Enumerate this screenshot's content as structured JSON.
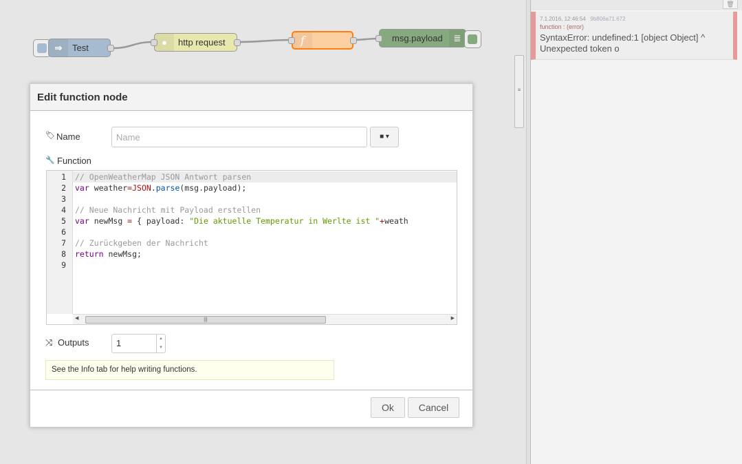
{
  "flow": {
    "nodes": [
      {
        "label": "Test",
        "color": "#a6bbcf"
      },
      {
        "label": "http request",
        "color": "#e7e7ae"
      },
      {
        "label": "",
        "color": "#fdd0a2"
      },
      {
        "label": "msg.payload",
        "color": "#87a980"
      }
    ]
  },
  "debug": {
    "timestamp": "7.1.2016, 12:46:54",
    "node_id": "9b806a71.672",
    "topic": "function : (error)",
    "payload": "SyntaxError: undefined:1 [object Object] ^ Unexpected token o"
  },
  "dialog": {
    "title": "Edit function node",
    "name_label": "Name",
    "name_placeholder": "Name",
    "name_value": "",
    "function_label": "Function",
    "code_lines": [
      [
        {
          "t": "// OpenWeatherMap JSON Antwort parsen",
          "c": "cm"
        }
      ],
      [
        {
          "t": "var",
          "c": "kw"
        },
        {
          "t": " weather",
          "c": "var"
        },
        {
          "t": "=",
          "c": "op"
        },
        {
          "t": "JSON",
          "c": "op"
        },
        {
          "t": ".",
          "c": "var"
        },
        {
          "t": "parse",
          "c": "prop"
        },
        {
          "t": "(msg.payload);",
          "c": "var"
        }
      ],
      [],
      [
        {
          "t": "// Neue Nachricht mit Payload erstellen",
          "c": "cm"
        }
      ],
      [
        {
          "t": "var",
          "c": "kw"
        },
        {
          "t": " newMsg ",
          "c": "var"
        },
        {
          "t": "=",
          "c": "op"
        },
        {
          "t": " { payload: ",
          "c": "var"
        },
        {
          "t": "\"Die aktuelle Temperatur in Werlte ist \"",
          "c": "str"
        },
        {
          "t": "+",
          "c": "op"
        },
        {
          "t": "weath",
          "c": "var"
        }
      ],
      [],
      [
        {
          "t": "// Zurückgeben der Nachricht",
          "c": "cm"
        }
      ],
      [
        {
          "t": "return",
          "c": "kw"
        },
        {
          "t": " newMsg;",
          "c": "var"
        }
      ],
      []
    ],
    "outputs_label": "Outputs",
    "outputs_value": "1",
    "tip": "See the Info tab for help writing functions.",
    "ok_label": "Ok",
    "cancel_label": "Cancel"
  }
}
